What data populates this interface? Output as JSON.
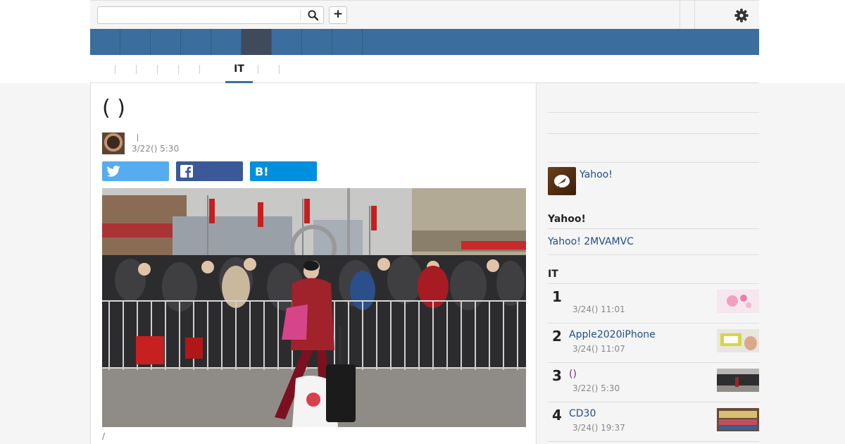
{
  "search": {
    "placeholder": "",
    "value": ""
  },
  "toolbar": {
    "plus_label": "+"
  },
  "subnav": {
    "active_label": "IT"
  },
  "article": {
    "headline": "(   )",
    "author": "",
    "date": "3/22() 5:30",
    "caption": "/"
  },
  "sidebar": {
    "promo_link": "Yahoo!",
    "section_heading": "Yahoo!",
    "sub_link": "Yahoo! 2MVAMVC",
    "ranking_heading": "IT",
    "ranking": [
      {
        "num": "1",
        "title": "",
        "date": "3/24() 11:01"
      },
      {
        "num": "2",
        "title": "Apple2020iPhone",
        "date": "3/24() 11:07"
      },
      {
        "num": "3",
        "title": "()",
        "date": "3/22() 5:30"
      },
      {
        "num": "4",
        "title": "CD30",
        "date": "3/24() 19:37"
      }
    ]
  },
  "colors": {
    "nav_blue": "#3b6e9e",
    "nav_active": "#3f4a5a",
    "twitter": "#55acee",
    "facebook": "#3b5998",
    "hatena": "#008fde",
    "link": "#1f4d8a"
  }
}
